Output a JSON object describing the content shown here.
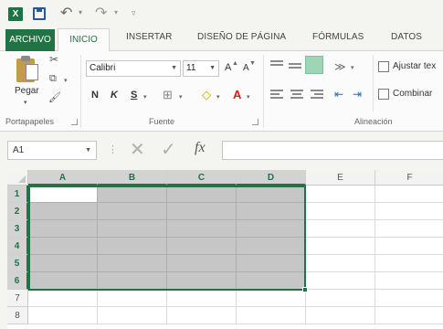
{
  "quick_access": {
    "app_icon": "X",
    "save_icon": "save-icon",
    "undo_glyph": "↶",
    "redo_glyph": "↷",
    "dropdown_glyph": "▾",
    "customize_glyph": "▿"
  },
  "tabs": {
    "file": "ARCHIVO",
    "home": "INICIO",
    "insert": "INSERTAR",
    "page_layout": "DISEÑO DE PÁGINA",
    "formulas": "FÓRMULAS",
    "data": "DATOS"
  },
  "ribbon": {
    "clipboard": {
      "label": "Portapapeles",
      "paste": "Pegar",
      "paste_dropdown": "▾",
      "cut_glyph": "✂",
      "copy_glyph": "⧉",
      "format_painter_glyph": "🖌"
    },
    "font": {
      "label": "Fuente",
      "font_name": "Calibri",
      "font_size": "11",
      "grow": "A",
      "shrink": "A",
      "bold": "N",
      "italic": "K",
      "underline": "S",
      "borders_glyph": "⊞",
      "fill_glyph": "◇",
      "font_color_glyph": "A"
    },
    "alignment": {
      "label": "Alineación",
      "orientation_glyph": "≫",
      "decrease_indent_glyph": "⇤",
      "increase_indent_glyph": "⇥",
      "wrap_text": "Ajustar tex",
      "merge_center": "Combinar"
    }
  },
  "formula_bar": {
    "name_box": "A1",
    "cancel_glyph": "✕",
    "enter_glyph": "✓",
    "fx": "fx",
    "dots": "⋮",
    "formula": ""
  },
  "grid": {
    "columns": [
      "A",
      "B",
      "C",
      "D",
      "E",
      "F"
    ],
    "rows": [
      "1",
      "2",
      "3",
      "4",
      "5",
      "6",
      "7",
      "8"
    ],
    "selected_columns": [
      "A",
      "B",
      "C",
      "D"
    ],
    "selected_rows": [
      "1",
      "2",
      "3",
      "4",
      "5",
      "6"
    ],
    "active_cell": "A1"
  },
  "colors": {
    "excel_green": "#217346",
    "selection_fill": "#c6c6c6",
    "header_selected": "#d3d3d3"
  }
}
